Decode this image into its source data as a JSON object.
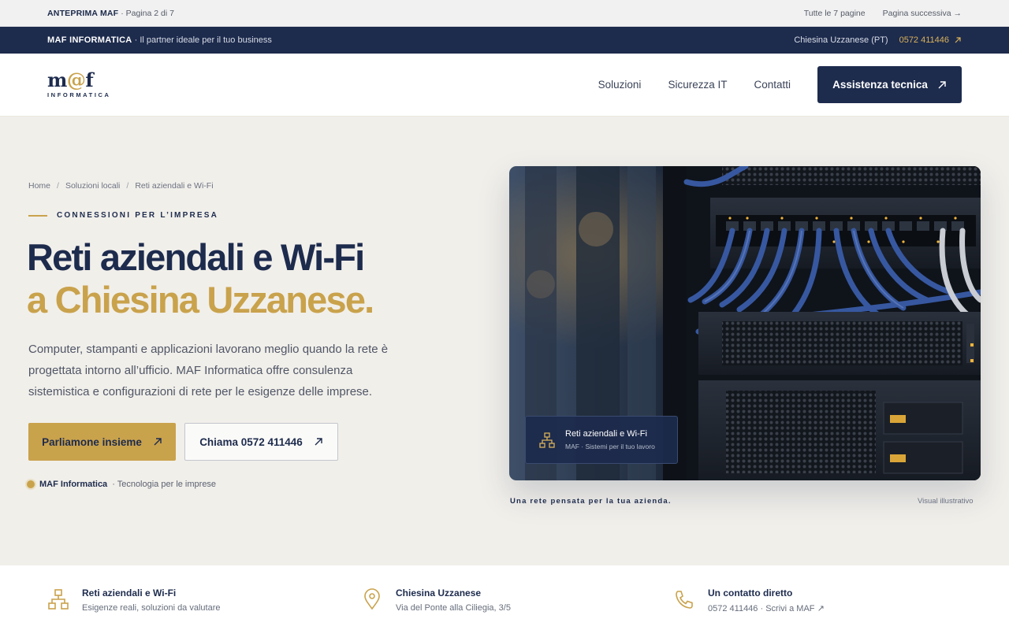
{
  "preview_bar": {
    "label": "ANTEPRIMA MAF",
    "page_info": "· Pagina 2 di 7",
    "all_pages": "Tutte le 7 pagine",
    "next_page": "Pagina successiva →"
  },
  "info_bar": {
    "brand": "MAF INFORMATICA",
    "slogan": "· Il partner ideale per il tuo business",
    "location": "Chiesina Uzzanese (PT)",
    "phone": "0572 411446"
  },
  "header": {
    "logo_main_prefix": "m",
    "logo_main_at": "@",
    "logo_main_suffix": "f",
    "logo_sub": "INFORMATICA",
    "nav": [
      "Soluzioni",
      "Sicurezza IT",
      "Contatti"
    ],
    "cta": "Assistenza tecnica"
  },
  "hero": {
    "breadcrumb": [
      "Home",
      "Soluzioni locali",
      "Reti aziendali e Wi-Fi"
    ],
    "eyebrow": "CONNESSIONI PER L’IMPRESA",
    "title_line1": "Reti aziendali e Wi-Fi",
    "title_line2": "a Chiesina Uzzanese.",
    "description": "Computer, stampanti e applicazioni lavorano meglio quando la rete è progettata intorno all’ufficio. MAF Informatica offre consulenza sistemistica e configurazioni di rete per le esigenze delle imprese.",
    "btn_primary": "Parliamone insieme",
    "btn_secondary": "Chiama 0572 411446",
    "tagline_brand": "MAF Informatica",
    "tagline_text": "· Tecnologia per le imprese"
  },
  "image": {
    "badge_title": "Reti aziendali e Wi-Fi",
    "badge_sub": "MAF · Sistemi per il tuo lavoro",
    "caption": "Una rete pensata per la tua azienda.",
    "note": "Visual illustrativo"
  },
  "features": [
    {
      "icon": "network-icon",
      "title": "Reti aziendali e Wi-Fi",
      "sub": "Esigenze reali, soluzioni da valutare"
    },
    {
      "icon": "map-pin-icon",
      "title": "Chiesina Uzzanese",
      "sub": "Via del Ponte alla Ciliegia, 3/5"
    },
    {
      "icon": "phone-icon",
      "title": "Un contatto diretto",
      "sub": "0572 411446 · Scrivi a MAF ↗"
    }
  ],
  "colors": {
    "navy": "#1d2b4d",
    "gold": "#c9a24c",
    "background": "#f1efea"
  }
}
